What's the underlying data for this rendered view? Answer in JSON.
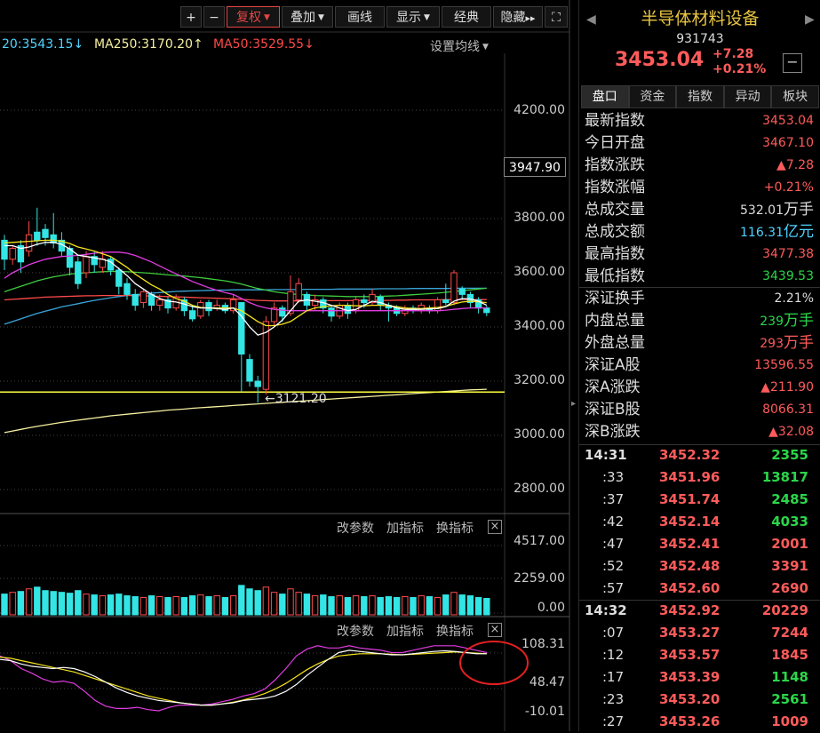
{
  "toolbar": {
    "plus": "+",
    "minus": "−",
    "fuquan": "复权",
    "diejia": "叠加",
    "huaxian": "画线",
    "xianshi": "显示",
    "jingdian": "经典",
    "yincang": "隐藏",
    "yincang_arrows": "▸▸",
    "fullscreen": "⛶"
  },
  "ma_legend": {
    "ma20": "20:3543.15",
    "ma20_arrow": "↓",
    "ma250": "MA250:3170.20",
    "ma250_arrow": "↑",
    "ma50": "MA50:3529.55",
    "ma50_arrow": "↓",
    "settings": "设置均线",
    "colors": {
      "ma20": "#4fd4ff",
      "ma250": "#f5f0a0",
      "ma50": "#ff4a4a"
    }
  },
  "price_axis": {
    "labels": [
      "4200.00",
      "3800.00",
      "3600.00",
      "3400.00",
      "3200.00",
      "3000.00",
      "2800.00"
    ],
    "values": [
      4200,
      3800,
      3600,
      3400,
      3200,
      3000,
      2800
    ],
    "current": "3947.90",
    "low_marker": "3121.20"
  },
  "volume_panel": {
    "gaicanshu": "改参数",
    "jiazhibiao": "加指标",
    "huanzhibiao": "换指标",
    "close": "×",
    "labels": [
      "4517.00",
      "2259.00",
      "0.00"
    ]
  },
  "macd_panel": {
    "gaicanshu": "改参数",
    "jiazhibiao": "加指标",
    "huanzhibiao": "换指标",
    "close": "×",
    "labels": [
      "108.31",
      "48.47",
      "-10.01"
    ]
  },
  "chart_data": {
    "type": "candlestick",
    "ylim": [
      2750,
      4350
    ],
    "candles": [
      {
        "o": 3720,
        "c": 3650,
        "h": 3740,
        "l": 3610
      },
      {
        "o": 3650,
        "c": 3690,
        "h": 3700,
        "l": 3630
      },
      {
        "o": 3700,
        "c": 3640,
        "h": 3720,
        "l": 3600
      },
      {
        "o": 3680,
        "c": 3740,
        "h": 3790,
        "l": 3660
      },
      {
        "o": 3750,
        "c": 3720,
        "h": 3840,
        "l": 3700
      },
      {
        "o": 3760,
        "c": 3730,
        "h": 3780,
        "l": 3700
      },
      {
        "o": 3740,
        "c": 3710,
        "h": 3820,
        "l": 3690
      },
      {
        "o": 3720,
        "c": 3680,
        "h": 3750,
        "l": 3660
      },
      {
        "o": 3690,
        "c": 3620,
        "h": 3700,
        "l": 3590
      },
      {
        "o": 3640,
        "c": 3560,
        "h": 3660,
        "l": 3540
      },
      {
        "o": 3600,
        "c": 3660,
        "h": 3680,
        "l": 3580
      },
      {
        "o": 3660,
        "c": 3630,
        "h": 3680,
        "l": 3600
      },
      {
        "o": 3620,
        "c": 3650,
        "h": 3680,
        "l": 3600
      },
      {
        "o": 3650,
        "c": 3610,
        "h": 3660,
        "l": 3590
      },
      {
        "o": 3610,
        "c": 3550,
        "h": 3620,
        "l": 3520
      },
      {
        "o": 3560,
        "c": 3520,
        "h": 3580,
        "l": 3500
      },
      {
        "o": 3520,
        "c": 3480,
        "h": 3540,
        "l": 3460
      },
      {
        "o": 3490,
        "c": 3530,
        "h": 3540,
        "l": 3470
      },
      {
        "o": 3520,
        "c": 3480,
        "h": 3530,
        "l": 3460
      },
      {
        "o": 3480,
        "c": 3500,
        "h": 3520,
        "l": 3460
      },
      {
        "o": 3500,
        "c": 3470,
        "h": 3510,
        "l": 3450
      },
      {
        "o": 3470,
        "c": 3510,
        "h": 3520,
        "l": 3460
      },
      {
        "o": 3500,
        "c": 3460,
        "h": 3510,
        "l": 3440
      },
      {
        "o": 3460,
        "c": 3430,
        "h": 3480,
        "l": 3420
      },
      {
        "o": 3440,
        "c": 3490,
        "h": 3500,
        "l": 3430
      },
      {
        "o": 3490,
        "c": 3460,
        "h": 3500,
        "l": 3440
      },
      {
        "o": 3470,
        "c": 3480,
        "h": 3500,
        "l": 3460
      },
      {
        "o": 3480,
        "c": 3460,
        "h": 3490,
        "l": 3450
      },
      {
        "o": 3460,
        "c": 3500,
        "h": 3520,
        "l": 3450
      },
      {
        "o": 3490,
        "c": 3300,
        "h": 3480,
        "l": 3160
      },
      {
        "o": 3280,
        "c": 3200,
        "h": 3300,
        "l": 3180
      },
      {
        "o": 3200,
        "c": 3180,
        "h": 3220,
        "l": 3121
      },
      {
        "o": 3170,
        "c": 3420,
        "h": 3440,
        "l": 3150
      },
      {
        "o": 3420,
        "c": 3470,
        "h": 3490,
        "l": 3400
      },
      {
        "o": 3470,
        "c": 3440,
        "h": 3480,
        "l": 3420
      },
      {
        "o": 3450,
        "c": 3530,
        "h": 3590,
        "l": 3440
      },
      {
        "o": 3500,
        "c": 3560,
        "h": 3580,
        "l": 3490
      },
      {
        "o": 3520,
        "c": 3480,
        "h": 3530,
        "l": 3460
      },
      {
        "o": 3480,
        "c": 3500,
        "h": 3520,
        "l": 3460
      },
      {
        "o": 3500,
        "c": 3470,
        "h": 3510,
        "l": 3450
      },
      {
        "o": 3470,
        "c": 3440,
        "h": 3480,
        "l": 3420
      },
      {
        "o": 3440,
        "c": 3480,
        "h": 3490,
        "l": 3430
      },
      {
        "o": 3480,
        "c": 3450,
        "h": 3490,
        "l": 3430
      },
      {
        "o": 3460,
        "c": 3500,
        "h": 3510,
        "l": 3450
      },
      {
        "o": 3500,
        "c": 3490,
        "h": 3520,
        "l": 3470
      },
      {
        "o": 3490,
        "c": 3520,
        "h": 3540,
        "l": 3480
      },
      {
        "o": 3510,
        "c": 3480,
        "h": 3520,
        "l": 3460
      },
      {
        "o": 3480,
        "c": 3470,
        "h": 3490,
        "l": 3420
      },
      {
        "o": 3470,
        "c": 3450,
        "h": 3480,
        "l": 3440
      },
      {
        "o": 3450,
        "c": 3470,
        "h": 3480,
        "l": 3440
      },
      {
        "o": 3470,
        "c": 3460,
        "h": 3480,
        "l": 3450
      },
      {
        "o": 3460,
        "c": 3480,
        "h": 3490,
        "l": 3450
      },
      {
        "o": 3470,
        "c": 3460,
        "h": 3480,
        "l": 3450
      },
      {
        "o": 3460,
        "c": 3500,
        "h": 3510,
        "l": 3450
      },
      {
        "o": 3500,
        "c": 3490,
        "h": 3560,
        "l": 3480
      },
      {
        "o": 3490,
        "c": 3600,
        "h": 3610,
        "l": 3480
      },
      {
        "o": 3540,
        "c": 3520,
        "h": 3550,
        "l": 3500
      },
      {
        "o": 3520,
        "c": 3490,
        "h": 3530,
        "l": 3470
      },
      {
        "o": 3500,
        "c": 3470,
        "h": 3510,
        "l": 3450
      },
      {
        "o": 3470,
        "c": 3453,
        "h": 3478,
        "l": 3440
      }
    ],
    "ma_white": [
      3700,
      3700,
      3690,
      3695,
      3705,
      3712,
      3712,
      3705,
      3688,
      3665,
      3660,
      3655,
      3650,
      3640,
      3615,
      3590,
      3560,
      3540,
      3520,
      3505,
      3495,
      3492,
      3485,
      3475,
      3470,
      3470,
      3468,
      3465,
      3470,
      3440,
      3400,
      3370,
      3380,
      3400,
      3425,
      3460,
      3495,
      3500,
      3495,
      3490,
      3480,
      3470,
      3460,
      3465,
      3480,
      3495,
      3490,
      3480,
      3470,
      3465,
      3465,
      3465,
      3467,
      3468,
      3475,
      3495,
      3505,
      3503,
      3495,
      3480
    ],
    "ma_yellow": [
      3710,
      3712,
      3714,
      3716,
      3718,
      3720,
      3720,
      3716,
      3708,
      3695,
      3688,
      3680,
      3670,
      3660,
      3640,
      3620,
      3595,
      3575,
      3555,
      3540,
      3520,
      3505,
      3495,
      3480,
      3472,
      3470,
      3470,
      3470,
      3470,
      3460,
      3440,
      3420,
      3405,
      3405,
      3410,
      3420,
      3440,
      3460,
      3470,
      3475,
      3478,
      3480,
      3480,
      3478,
      3478,
      3480,
      3480,
      3478,
      3475,
      3470,
      3468,
      3468,
      3470,
      3472,
      3476,
      3485,
      3492,
      3495,
      3493,
      3490
    ],
    "ma_magenta": [
      3580,
      3600,
      3615,
      3630,
      3640,
      3650,
      3655,
      3660,
      3662,
      3664,
      3668,
      3672,
      3675,
      3676,
      3676,
      3672,
      3664,
      3652,
      3640,
      3625,
      3610,
      3596,
      3582,
      3568,
      3556,
      3545,
      3535,
      3527,
      3520,
      3505,
      3490,
      3478,
      3470,
      3465,
      3462,
      3460,
      3460,
      3460,
      3460,
      3460,
      3460,
      3460,
      3460,
      3460,
      3460,
      3460,
      3460,
      3460,
      3460,
      3460,
      3460,
      3460,
      3460,
      3460,
      3462,
      3465,
      3468,
      3470,
      3470,
      3470
    ],
    "ma_green": [
      3530,
      3540,
      3550,
      3560,
      3570,
      3578,
      3585,
      3590,
      3595,
      3598,
      3600,
      3602,
      3604,
      3605,
      3605,
      3604,
      3602,
      3600,
      3598,
      3595,
      3592,
      3590,
      3588,
      3585,
      3582,
      3578,
      3574,
      3570,
      3565,
      3558,
      3550,
      3542,
      3536,
      3530,
      3526,
      3522,
      3520,
      3518,
      3516,
      3515,
      3514,
      3513,
      3512,
      3512,
      3512,
      3512,
      3513,
      3514,
      3515,
      3517,
      3519,
      3521,
      3523,
      3525,
      3528,
      3531,
      3534,
      3537,
      3540,
      3543
    ],
    "ma_blue": [
      3410,
      3420,
      3430,
      3440,
      3450,
      3458,
      3466,
      3474,
      3480,
      3486,
      3492,
      3498,
      3503,
      3508,
      3512,
      3516,
      3519,
      3522,
      3525,
      3527,
      3529,
      3531,
      3532,
      3533,
      3534,
      3535,
      3536,
      3536,
      3537,
      3537,
      3537,
      3537,
      3537,
      3538,
      3538,
      3538,
      3538,
      3539,
      3539,
      3539,
      3539,
      3540,
      3540,
      3540,
      3540,
      3540,
      3541,
      3541,
      3541,
      3541,
      3542,
      3542,
      3542,
      3542,
      3542,
      3543,
      3543,
      3543,
      3543,
      3543
    ],
    "ma_red": [
      3500,
      3502,
      3504,
      3506,
      3508,
      3510,
      3511,
      3512,
      3513,
      3514,
      3515,
      3515,
      3516,
      3516,
      3516,
      3516,
      3516,
      3515,
      3514,
      3513,
      3512,
      3511,
      3510,
      3509,
      3508,
      3507,
      3506,
      3505,
      3504,
      3502,
      3500,
      3498,
      3497,
      3496,
      3496,
      3496,
      3496,
      3496,
      3497,
      3497,
      3497,
      3497,
      3497,
      3498,
      3498,
      3498,
      3498,
      3498,
      3499,
      3499,
      3500,
      3500,
      3500,
      3500,
      3501,
      3501,
      3501,
      3501,
      3501,
      3501
    ],
    "ma250": [
      3010,
      3016,
      3022,
      3028,
      3033,
      3038,
      3043,
      3048,
      3052,
      3056,
      3060,
      3064,
      3068,
      3072,
      3075,
      3078,
      3081,
      3084,
      3087,
      3090,
      3093,
      3095,
      3097,
      3100,
      3102,
      3104,
      3106,
      3108,
      3110,
      3112,
      3114,
      3116,
      3118,
      3120,
      3122,
      3124,
      3126,
      3128,
      3130,
      3132,
      3134,
      3136,
      3138,
      3140,
      3142,
      3144,
      3146,
      3148,
      3150,
      3152,
      3154,
      3156,
      3158,
      3160,
      3162,
      3164,
      3166,
      3168,
      3169,
      3170
    ],
    "support_line": 3160,
    "volume": [
      1200,
      1300,
      1350,
      1500,
      1600,
      1400,
      1350,
      1300,
      1250,
      1400,
      1200,
      1150,
      1100,
      1150,
      1200,
      1100,
      1050,
      1000,
      1100,
      1050,
      1000,
      1050,
      1000,
      1100,
      1150,
      1050,
      1100,
      1000,
      1100,
      1700,
      1500,
      1400,
      1600,
      1300,
      1200,
      1500,
      1300,
      1200,
      1100,
      1150,
      1050,
      1100,
      1000,
      1100,
      1050,
      1100,
      1000,
      1050,
      1000,
      1050,
      1000,
      1100,
      1050,
      1000,
      1150,
      1300,
      1150,
      1100,
      1000,
      950
    ],
    "vol_max": 4517,
    "macd_a": [
      80,
      78,
      72,
      68,
      66,
      64,
      66,
      64,
      58,
      50,
      40,
      30,
      22,
      16,
      12,
      8,
      6,
      4,
      2,
      0,
      0,
      2,
      4,
      8,
      10,
      12,
      16,
      24,
      36,
      52,
      66,
      80,
      92,
      96,
      94,
      92,
      90,
      88,
      88,
      90,
      92,
      94,
      95,
      94,
      92,
      90,
      90
    ],
    "macd_b": [
      84,
      82,
      78,
      74,
      70,
      66,
      62,
      58,
      52,
      46,
      40,
      34,
      28,
      22,
      16,
      12,
      8,
      4,
      2,
      0,
      0,
      2,
      5,
      9,
      14,
      20,
      28,
      38,
      50,
      62,
      72,
      80,
      86,
      88,
      90,
      90,
      90,
      89,
      88,
      89,
      90,
      91,
      92,
      93,
      92,
      91,
      90
    ],
    "macd_c": [
      86,
      78,
      64,
      56,
      46,
      40,
      42,
      38,
      24,
      8,
      -2,
      -6,
      -6,
      -4,
      -8,
      -10,
      -4,
      0,
      0,
      0,
      2,
      6,
      10,
      16,
      20,
      28,
      44,
      64,
      86,
      98,
      104,
      100,
      100,
      104,
      100,
      98,
      96,
      92,
      92,
      96,
      100,
      104,
      104,
      104,
      100,
      96,
      92
    ],
    "macd_ylim": [
      -10.01,
      108.31
    ]
  },
  "right_panel": {
    "title": "半导体材料设备",
    "code": "931743",
    "price": "3453.04",
    "change": "+7.28",
    "change_pct": "+0.21%",
    "minimize": "−",
    "nav_left": "◀",
    "nav_right": "▶",
    "tabs": [
      "盘口",
      "资金",
      "指数",
      "异动",
      "板块"
    ],
    "stats": [
      {
        "label": "最新指数",
        "value": "3453.04",
        "color": "red"
      },
      {
        "label": "今日开盘",
        "value": "3467.10",
        "color": "red"
      },
      {
        "label": "指数涨跌",
        "value": "▲7.28",
        "color": "red"
      },
      {
        "label": "指数涨幅",
        "value": "+0.21%",
        "color": "red"
      },
      {
        "label": "总成交量",
        "value": "532.01",
        "unit": "万手",
        "color": "white"
      },
      {
        "label": "总成交额",
        "value": "116.31",
        "unit": "亿元",
        "color": "cyan"
      },
      {
        "label": "最高指数",
        "value": "3477.38",
        "color": "red"
      },
      {
        "label": "最低指数",
        "value": "3439.53",
        "color": "green"
      }
    ],
    "stats2": [
      {
        "label": "深证换手",
        "value": "2.21%",
        "color": "white"
      },
      {
        "label": "内盘总量",
        "value": "239",
        "unit": "万手",
        "color": "green"
      },
      {
        "label": "外盘总量",
        "value": "293",
        "unit": "万手",
        "color": "red"
      },
      {
        "label": "深证A股",
        "value": "13596.55",
        "color": "red"
      },
      {
        "label": "深A涨跌",
        "value": "▲211.90",
        "color": "red"
      },
      {
        "label": "深证B股",
        "value": "8066.31",
        "color": "red"
      },
      {
        "label": "深B涨跌",
        "value": "▲32.08",
        "color": "red"
      }
    ],
    "ticks": [
      {
        "time": "14:31",
        "price": "3452.32",
        "vol": "2355",
        "vcolor": "green",
        "main": true
      },
      {
        "time": ":33",
        "price": "3451.96",
        "vol": "13817",
        "vcolor": "green"
      },
      {
        "time": ":37",
        "price": "3451.74",
        "vol": "2485",
        "vcolor": "green"
      },
      {
        "time": ":42",
        "price": "3452.14",
        "vol": "4033",
        "vcolor": "green"
      },
      {
        "time": ":47",
        "price": "3452.41",
        "vol": "2001",
        "vcolor": "red"
      },
      {
        "time": ":52",
        "price": "3452.48",
        "vol": "3391",
        "vcolor": "red"
      },
      {
        "time": ":57",
        "price": "3452.60",
        "vol": "2690",
        "vcolor": "red"
      },
      {
        "time": "14:32",
        "price": "3452.92",
        "vol": "20229",
        "vcolor": "red",
        "main": true
      },
      {
        "time": ":07",
        "price": "3453.27",
        "vol": "7244",
        "vcolor": "red"
      },
      {
        "time": ":12",
        "price": "3453.57",
        "vol": "1845",
        "vcolor": "red"
      },
      {
        "time": ":17",
        "price": "3453.39",
        "vol": "1148",
        "vcolor": "green"
      },
      {
        "time": ":23",
        "price": "3453.20",
        "vol": "2561",
        "vcolor": "green"
      },
      {
        "time": ":27",
        "price": "3453.26",
        "vol": "1009",
        "vcolor": "red"
      }
    ]
  }
}
